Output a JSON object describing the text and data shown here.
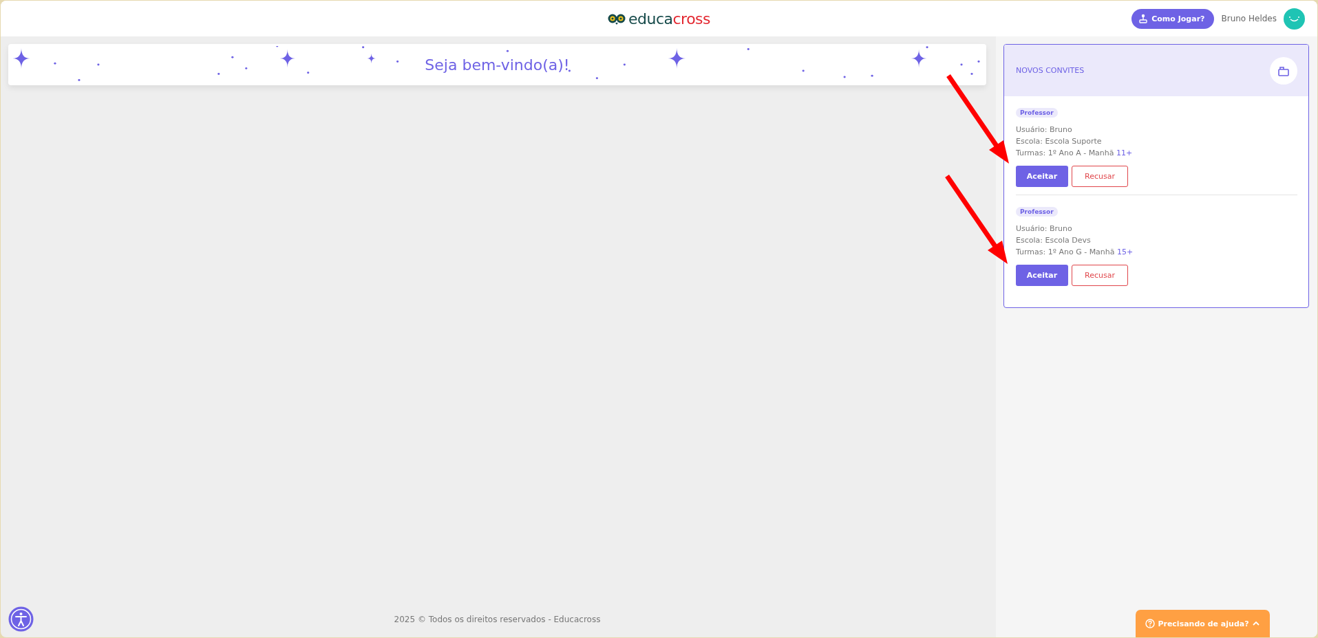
{
  "header": {
    "logo": {
      "part_1": "educa",
      "part_2": "cross"
    },
    "help_button": "Como Jogar?",
    "user_name": "Bruno Heldes"
  },
  "welcome_banner": {
    "title": "Seja bem-vindo(a)!"
  },
  "invites_panel": {
    "title": "NOVOS CONVITES",
    "invites": [
      {
        "role": "Professor",
        "user": "Usuário: Bruno",
        "school": "Escola: Escola Suporte",
        "classes": "Turmas: 1º Ano A - Manhã",
        "more": "11+",
        "accept": "Aceitar",
        "decline": "Recusar"
      },
      {
        "role": "Professor",
        "user": "Usuário: Bruno",
        "school": "Escola: Escola Devs",
        "classes": "Turmas: 1º Ano G - Manhã",
        "more": "15+",
        "accept": "Aceitar",
        "decline": "Recusar"
      }
    ]
  },
  "footer": {
    "copyright": "2025 © Todos os direitos reservados - Educacross"
  },
  "help_tab": {
    "label": "Precisando de ajuda?"
  }
}
